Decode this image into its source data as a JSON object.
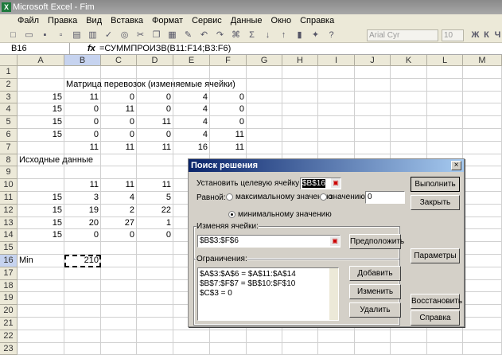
{
  "window": {
    "title": "Microsoft Excel - Fim"
  },
  "menu": [
    "Файл",
    "Правка",
    "Вид",
    "Вставка",
    "Формат",
    "Сервис",
    "Данные",
    "Окно",
    "Справка"
  ],
  "toolbar": {
    "font": "Arial Cyr",
    "size": "10"
  },
  "formula_bar": {
    "name_box": "B16",
    "fx": "fx",
    "formula": "=СУММПРОИЗВ(B11:F14;B3:F6)"
  },
  "columns": [
    "A",
    "B",
    "C",
    "D",
    "E",
    "F",
    "G",
    "H",
    "I",
    "J",
    "K",
    "L",
    "M"
  ],
  "rows": [
    "1",
    "2",
    "3",
    "4",
    "5",
    "6",
    "7",
    "8",
    "9",
    "10",
    "11",
    "12",
    "13",
    "14",
    "15",
    "16",
    "17",
    "18",
    "19",
    "20",
    "21",
    "22",
    "23"
  ],
  "cells": {
    "B2": "Матрица перевозок (изменяемые ячейки)",
    "A3": "15",
    "B3": "11",
    "C3": "0",
    "D3": "0",
    "E3": "4",
    "F3": "0",
    "A4": "15",
    "B4": "0",
    "C4": "11",
    "D4": "0",
    "E4": "4",
    "F4": "0",
    "A5": "15",
    "B5": "0",
    "C5": "0",
    "D5": "11",
    "E5": "4",
    "F5": "0",
    "A6": "15",
    "B6": "0",
    "C6": "0",
    "D6": "0",
    "E6": "4",
    "F6": "11",
    "B7": "11",
    "C7": "11",
    "D7": "11",
    "E7": "16",
    "F7": "11",
    "A8": "Исходные данные",
    "B10": "11",
    "C10": "11",
    "D10": "11",
    "A11": "15",
    "B11": "3",
    "C11": "4",
    "D11": "5",
    "A12": "15",
    "B12": "19",
    "C12": "2",
    "D12": "22",
    "A13": "15",
    "B13": "20",
    "C13": "27",
    "D13": "1",
    "A14": "15",
    "B14": "0",
    "C14": "0",
    "D14": "0",
    "A16": "Min",
    "B16": "210"
  },
  "dialog": {
    "title": "Поиск решения",
    "target_label": "Установить целевую ячейку:",
    "target_value": "$B$16",
    "equal_label": "Равной:",
    "opt_max": "максимальному значению",
    "opt_value": "значению:",
    "value_input": "0",
    "opt_min": "минимальному значению",
    "selected_option": "min",
    "changing_label": "Изменяя ячейки:",
    "changing_value": "$B$3:$F$6",
    "guess_button": "Предположить",
    "constraints_label": "Ограничения:",
    "constraints": [
      "$A$3:$A$6 = $A$11:$A$14",
      "$B$7:$F$7 = $B$10:$F$10",
      "$C$3 = 0"
    ],
    "add_button": "Добавить",
    "change_button": "Изменить",
    "delete_button": "Удалить",
    "solve_button": "Выполнить",
    "close_button": "Закрыть",
    "options_button": "Параметры",
    "reset_button": "Восстановить",
    "help_button": "Справка"
  }
}
